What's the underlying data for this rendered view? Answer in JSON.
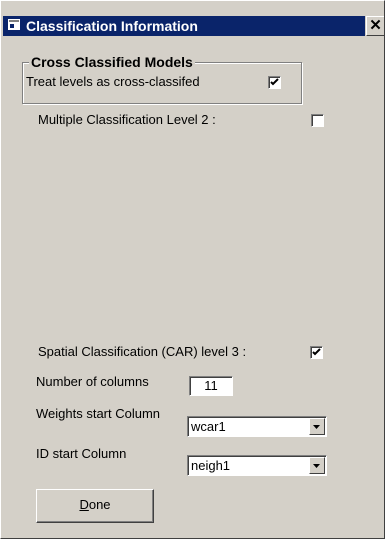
{
  "window": {
    "title": "Classification Information",
    "close_glyph": "✕",
    "title_icon": "window-app-icon"
  },
  "cross_classified": {
    "group_title": "Cross Classified Models",
    "treat_label": "Treat levels as cross-classifed",
    "treat_checked": true
  },
  "multiple_classification": {
    "label": "Multiple Classification Level 2 :",
    "checked": false
  },
  "spatial": {
    "label": "Spatial Classification (CAR) level 3 :",
    "checked": true
  },
  "num_columns": {
    "label": "Number of columns",
    "value": "11"
  },
  "weights_start": {
    "label": "Weights start Column",
    "value": "wcar1"
  },
  "id_start": {
    "label": "ID start Column",
    "value": "neigh1"
  },
  "done_button": {
    "mnemonic": "D",
    "rest": "one"
  },
  "colors": {
    "titlebar": "#0a246a",
    "face": "#d4d0c8"
  }
}
